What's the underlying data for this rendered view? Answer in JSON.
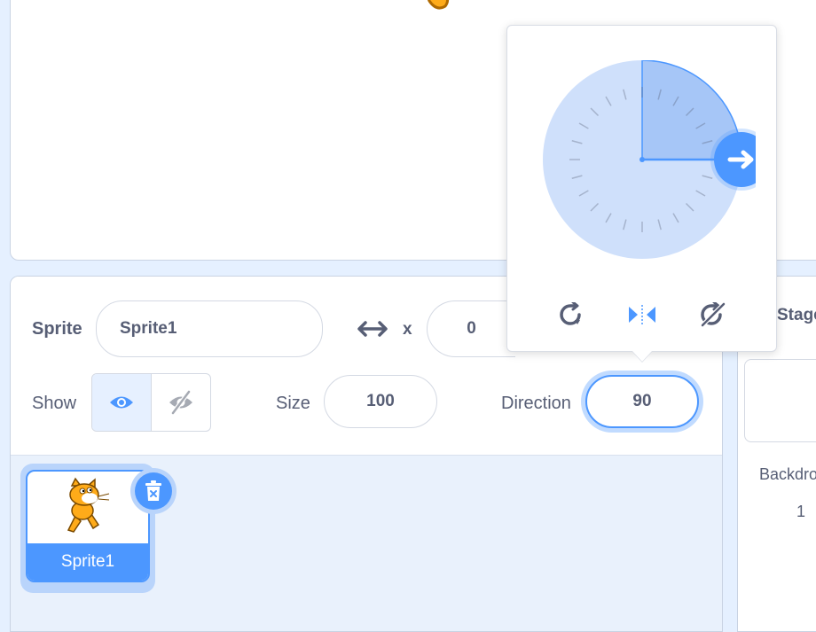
{
  "sprite_info": {
    "sprite_label": "Sprite",
    "sprite_name": "Sprite1",
    "x_label": "x",
    "x_value": "0",
    "show_label": "Show",
    "size_label": "Size",
    "size_value": "100",
    "direction_label": "Direction",
    "direction_value": "90"
  },
  "direction_popover": {
    "direction": 90,
    "rotation_styles": [
      "all-around-icon",
      "left-right-icon",
      "dont-rotate-icon"
    ],
    "selected_style": "left-right"
  },
  "sprite_list": {
    "items": [
      {
        "name": "Sprite1",
        "selected": true
      }
    ]
  },
  "stage_panel": {
    "title": "Stage",
    "backdrops_label": "Backdrops",
    "backdrops_count": "1"
  },
  "colors": {
    "accent": "#4c97ff",
    "text": "#575e75",
    "background": "#e5f0ff"
  }
}
